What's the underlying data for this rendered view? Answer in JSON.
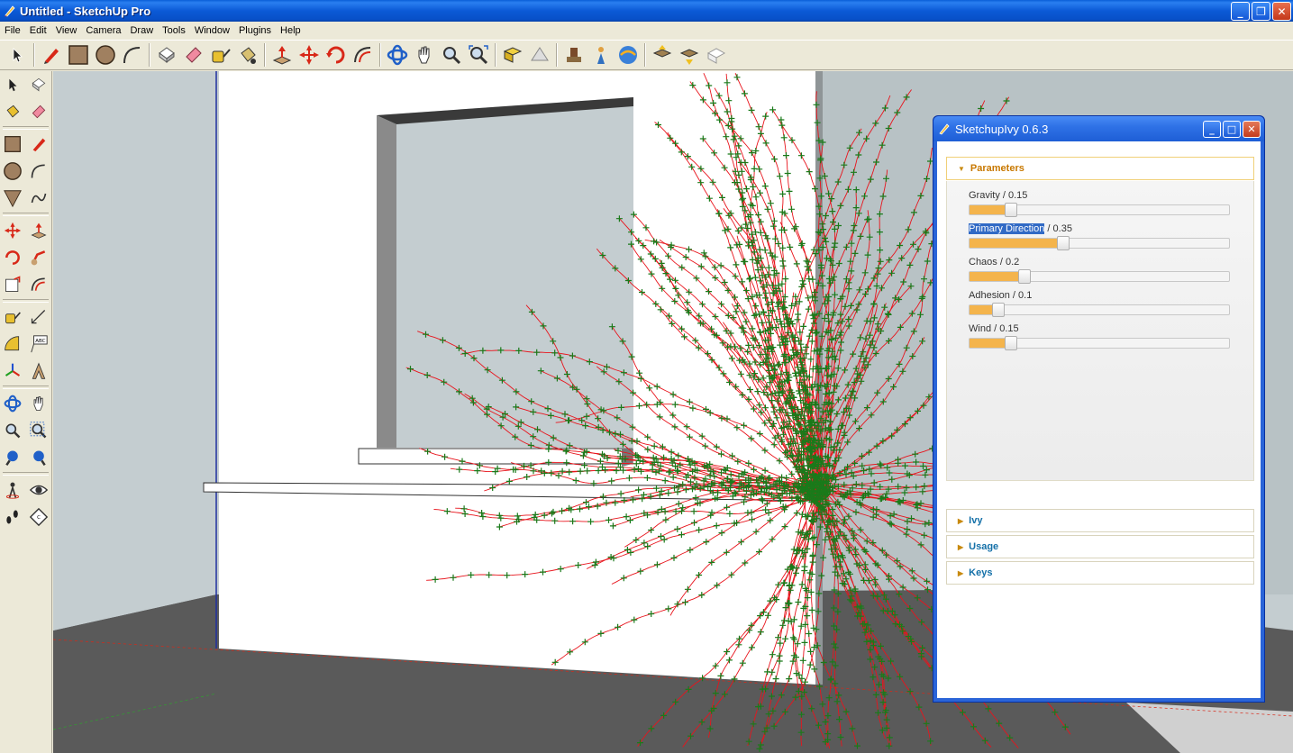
{
  "window": {
    "title": "Untitled - SketchUp Pro"
  },
  "menu": {
    "items": [
      "File",
      "Edit",
      "View",
      "Camera",
      "Draw",
      "Tools",
      "Window",
      "Plugins",
      "Help"
    ]
  },
  "toolbar": {
    "icons": [
      "select-icon",
      "pencil-icon",
      "rectangle-icon",
      "circle-icon",
      "arc-icon",
      "make-component-icon",
      "eraser-icon",
      "tape-measure-icon",
      "paint-bucket-icon",
      "push-pull-icon",
      "move-icon",
      "rotate-icon",
      "offset-icon",
      "orbit-icon",
      "pan-icon",
      "zoom-icon",
      "zoom-extents-icon",
      "get-models-icon",
      "share-model-icon",
      "google-earth-icon",
      "place-model-icon",
      "get-photo-texture-icon",
      "upload-icon",
      "download-icon",
      "components-icon"
    ]
  },
  "ivy_panel": {
    "title": "SketchupIvy 0.6.3",
    "sections": {
      "parameters": "Parameters",
      "ivy": "Ivy",
      "usage": "Usage",
      "keys": "Keys"
    },
    "params": [
      {
        "name": "Gravity",
        "value_text": " / 0.15",
        "value": 0.15,
        "highlighted": false
      },
      {
        "name": "Primary Direction",
        "value_text": " / 0.35",
        "value": 0.35,
        "highlighted": true
      },
      {
        "name": "Chaos",
        "value_text": " / 0.2",
        "value": 0.2,
        "highlighted": false
      },
      {
        "name": "Adhesion",
        "value_text": " / 0.1",
        "value": 0.1,
        "highlighted": false
      },
      {
        "name": "Wind",
        "value_text": " / 0.15",
        "value": 0.15,
        "highlighted": false
      }
    ]
  },
  "colors": {
    "ivy_stem": "#e8141c",
    "ivy_leaf": "#1a7a1a",
    "slider_fill": "#f4b44c",
    "ground": "#5a5a5a",
    "sky": "#c4cdd0",
    "wall": "#ffffff"
  }
}
